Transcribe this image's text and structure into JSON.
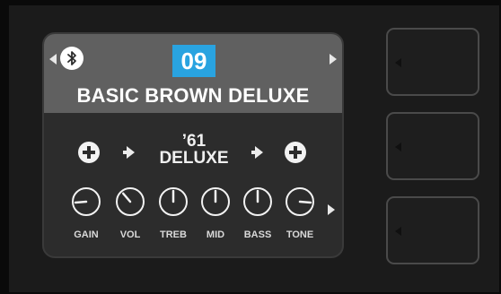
{
  "colors": {
    "accent_blue": "#29a3e0",
    "panel_bg": "#2c2c2c",
    "header_bg": "#606060",
    "page_bg": "#0a0a0a"
  },
  "header": {
    "preset_number": "09",
    "preset_name": "BASIC BROWN DELUXE",
    "bluetooth_icon": "bluetooth-icon",
    "prev_icon": "triangle-left-icon",
    "next_icon": "triangle-right-icon"
  },
  "signal_chain": {
    "amp_line1": "’61",
    "amp_line2": "DELUXE",
    "add_icon": "plus-circle-icon",
    "arrow_icon": "arrow-right-icon"
  },
  "knobs": [
    {
      "label": "GAIN",
      "level": 0.15
    },
    {
      "label": "VOL",
      "level": 0.35
    },
    {
      "label": "TREB",
      "level": 0.5
    },
    {
      "label": "MID",
      "level": 0.5
    },
    {
      "label": "BASS",
      "level": 0.5
    },
    {
      "label": "TONE",
      "level": 0.85
    }
  ],
  "side_buttons": [
    {
      "icon": "triangle-left-icon"
    },
    {
      "icon": "triangle-left-icon"
    },
    {
      "icon": "triangle-left-icon"
    }
  ]
}
